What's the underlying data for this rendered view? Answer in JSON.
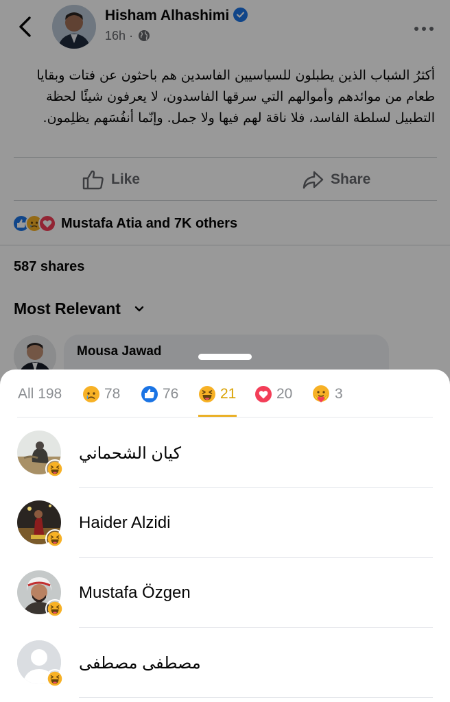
{
  "post": {
    "author": "Hisham Alhashimi",
    "time": "16h",
    "separator": "·",
    "text": "أكثرُ الشباب الذين يطبلون للسياسيين الفاسدين هم باحثون عن فتات وبقايا طعام من موائدهم وأموالهم التي سرقها الفاسدون، لا يعرفون شيئًا لحظة التطبيل لسلطة الفاسد، فلا ناقة لهم فيها ولا جمل. وإنّما أنفُسَهم يظلِمون.",
    "like_label": "Like",
    "share_label": "Share",
    "reactions_summary": "Mustafa Atia and 7K others",
    "shares": "587 shares",
    "sort_label": "Most Relevant",
    "comment_author": "Mousa Jawad"
  },
  "sheet": {
    "tabs": [
      {
        "label": "All",
        "count": "198",
        "icon": "all"
      },
      {
        "label": "",
        "count": "78",
        "icon": "sad"
      },
      {
        "label": "",
        "count": "76",
        "icon": "like"
      },
      {
        "label": "",
        "count": "21",
        "icon": "haha"
      },
      {
        "label": "",
        "count": "20",
        "icon": "love"
      },
      {
        "label": "",
        "count": "3",
        "icon": "care"
      }
    ],
    "people": [
      {
        "name": "كيان الشحماني",
        "reaction": "haha"
      },
      {
        "name": "Haider Alzidi",
        "reaction": "haha"
      },
      {
        "name": "Mustafa Özgen",
        "reaction": "haha"
      },
      {
        "name": "مصطفى مصطفى",
        "reaction": "haha"
      }
    ]
  },
  "colors": {
    "brand_blue": "#1b74e4",
    "haha_yellow": "#f7b125",
    "active_tab": "#d9a100",
    "love_red": "#f33e58"
  }
}
